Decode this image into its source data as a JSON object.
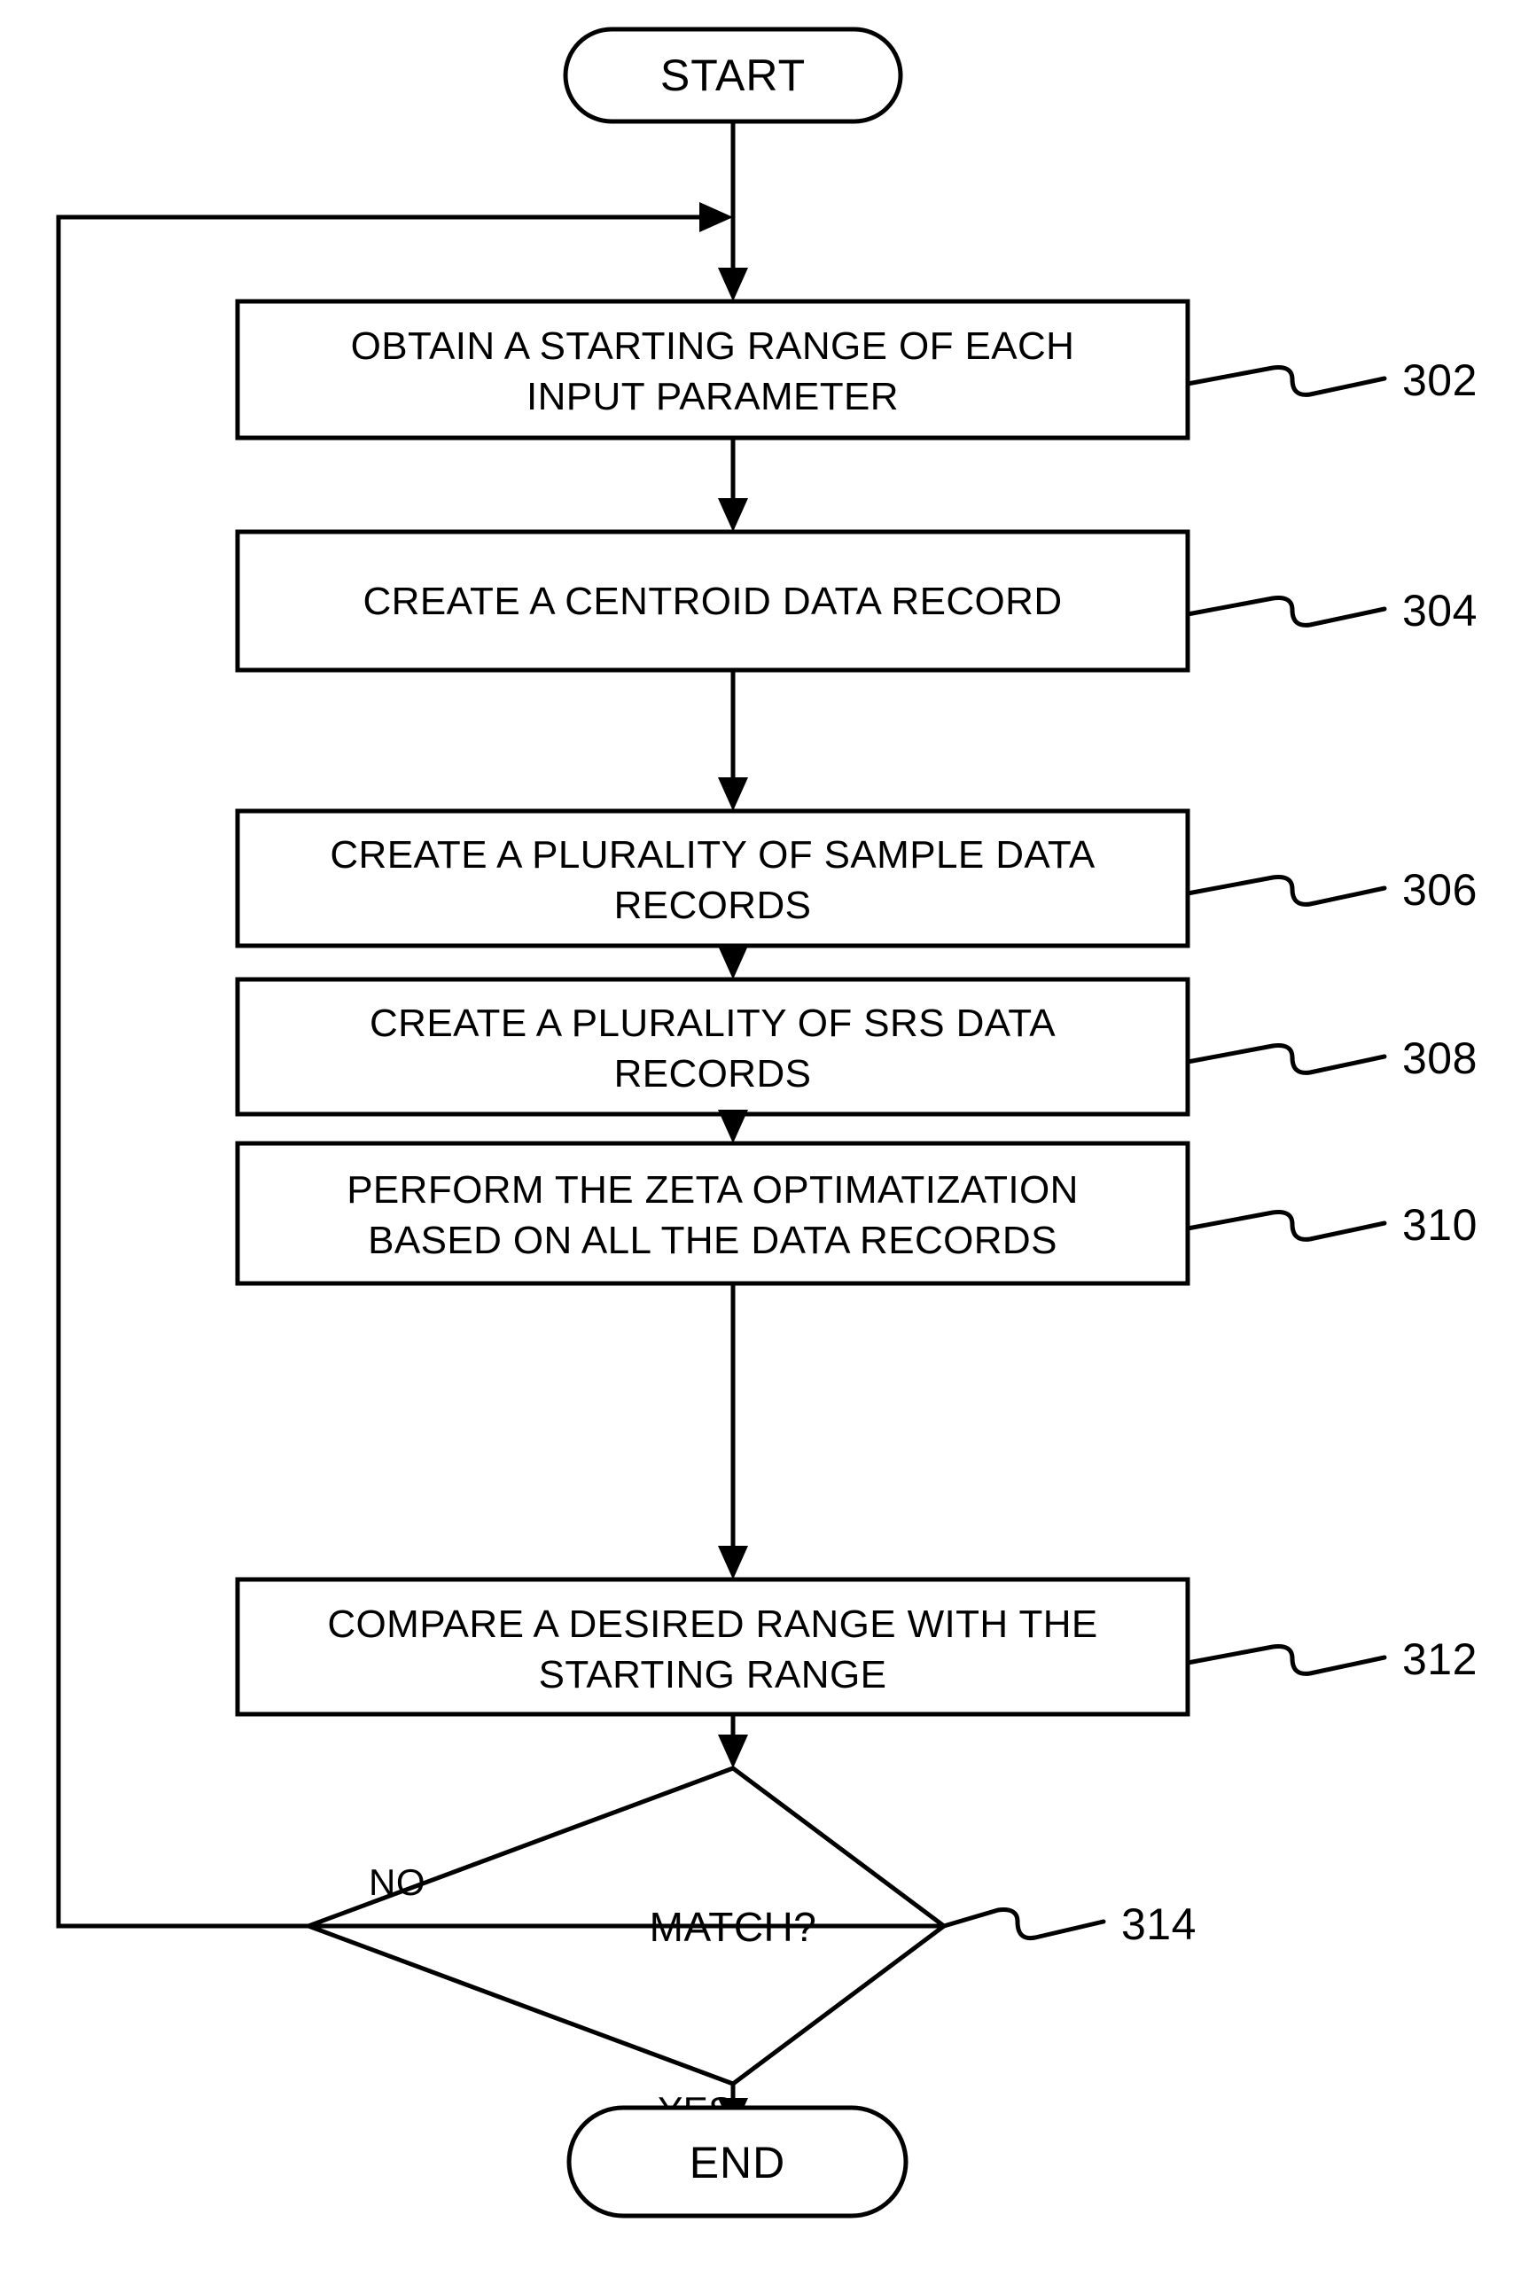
{
  "diagram": {
    "type": "flowchart",
    "title": "",
    "terminals": {
      "start": {
        "label": "START"
      },
      "end": {
        "label": "END"
      }
    },
    "steps": [
      {
        "ref": "302",
        "line1": "OBTAIN A STARTING RANGE OF EACH",
        "line2": "INPUT PARAMETER"
      },
      {
        "ref": "304",
        "line1": "CREATE A CENTROID DATA RECORD",
        "line2": ""
      },
      {
        "ref": "306",
        "line1": "CREATE A PLURALITY OF SAMPLE DATA",
        "line2": "RECORDS"
      },
      {
        "ref": "308",
        "line1": "CREATE A PLURALITY OF SRS DATA",
        "line2": "RECORDS"
      },
      {
        "ref": "310",
        "line1": "PERFORM THE ZETA OPTIMATIZATION",
        "line2": "BASED ON ALL THE DATA RECORDS"
      },
      {
        "ref": "312",
        "line1": "COMPARE A DESIRED RANGE WITH THE",
        "line2": "STARTING RANGE"
      }
    ],
    "decision": {
      "ref": "314",
      "label": "MATCH?",
      "branch_no": "NO",
      "branch_yes": "YES"
    },
    "colors": {
      "stroke": "#000000",
      "fill": "#ffffff",
      "text": "#000000"
    }
  }
}
